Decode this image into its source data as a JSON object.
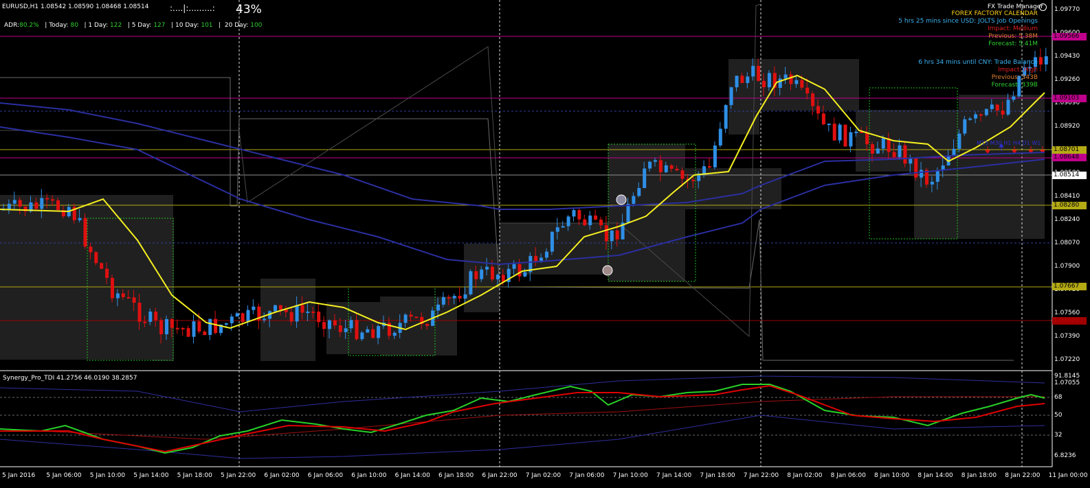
{
  "header": {
    "symbol_info": "EURUSD,H1  1.08542 1.08590 1.08468 1.08514",
    "time_bar": ":....|:.........:",
    "percent": "43%",
    "adr_label": "ADR:",
    "adr_value": "80.2%",
    "today_label": "Today:",
    "today_value": "80",
    "day1_label": "1 Day:",
    "day1_value": "122",
    "day5_label": "5 Day:",
    "day5_value": "127",
    "day10_label": "10 Day:",
    "day10_value": "101",
    "day20_label": "20 Day:",
    "day20_value": "100"
  },
  "news": {
    "manager": "FX Trade Manager",
    "calendar": "FOREX FACTORY CALENDAR",
    "event1": "5 hrs 25 mins since USD: JOLTS Job Openings",
    "event1_impact": "Impact: Medium",
    "event1_previous": "Previous: 5.38M",
    "event1_forecast": "Forecast: 5.41M",
    "event2": "6 hrs 34 mins until CNY: Trade Balance",
    "event2_impact": "Impact: High",
    "event2_previous": "Previous: 343B",
    "event2_forecast": "Forecast: 339B",
    "tf_row": "M15  M30  H1  H4  D1  W1"
  },
  "price_axis": [
    "1.09770",
    "1.09600",
    "1.09430",
    "1.09260",
    "1.09090",
    "1.08920",
    "1.08750",
    "1.08580",
    "1.08410",
    "1.08240",
    "1.08070",
    "1.07900",
    "1.07730",
    "1.07560",
    "1.07390",
    "1.07220",
    "1.07055"
  ],
  "price_tags": {
    "magenta_top": "1.09566",
    "magenta_mid": "1.09103",
    "olive_1": "1.08701",
    "magenta_2": "1.08648",
    "current": "1.08514",
    "olive_2": "1.08280",
    "olive_3": "1.07667",
    "red_1": "1.07420"
  },
  "indicator": {
    "title": "Synergy_Pro_TDI 41.2756 46.0190 38.2857",
    "levels": [
      "91.8145",
      "68",
      "50",
      "32",
      "6.8236"
    ]
  },
  "time_axis": [
    "5 Jan 2016",
    "5 Jan 06:00",
    "5 Jan 10:00",
    "5 Jan 14:00",
    "5 Jan 18:00",
    "5 Jan 22:00",
    "6 Jan 02:00",
    "6 Jan 06:00",
    "6 Jan 10:00",
    "6 Jan 14:00",
    "6 Jan 18:00",
    "6 Jan 22:00",
    "7 Jan 02:00",
    "7 Jan 06:00",
    "7 Jan 10:00",
    "7 Jan 14:00",
    "7 Jan 18:00",
    "7 Jan 22:00",
    "8 Jan 02:00",
    "8 Jan 06:00",
    "8 Jan 10:00",
    "8 Jan 14:00",
    "8 Jan 18:00",
    "8 Jan 22:00",
    "11 Jan 00:00"
  ],
  "colors": {
    "bull": "#2f8fe6",
    "bear": "#e01010",
    "ma_yellow": "#f5f020",
    "ma_blue": "#2b2fa0",
    "tdi_green": "#28d228",
    "tdi_red": "#e00000",
    "magenta": "#c0008c",
    "olive": "#b4aa14"
  }
}
